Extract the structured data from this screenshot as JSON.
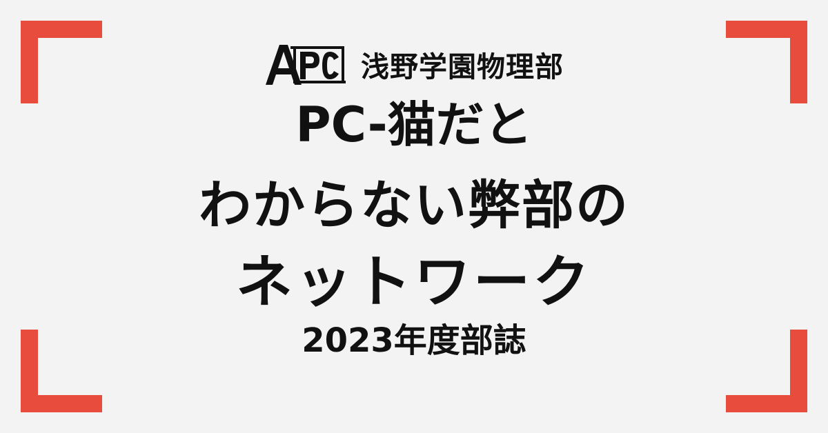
{
  "logo": {
    "text": "APC",
    "icon": "apc-logo-icon"
  },
  "club_name": "浅野学園物理部",
  "title": {
    "line1": "PC-猫だと",
    "line2": "わからない弊部の",
    "line3": "ネットワーク"
  },
  "subtitle": "2023年度部誌",
  "colors": {
    "background": "#f3f3f3",
    "accent": "#e84c3d",
    "text": "#111111"
  }
}
